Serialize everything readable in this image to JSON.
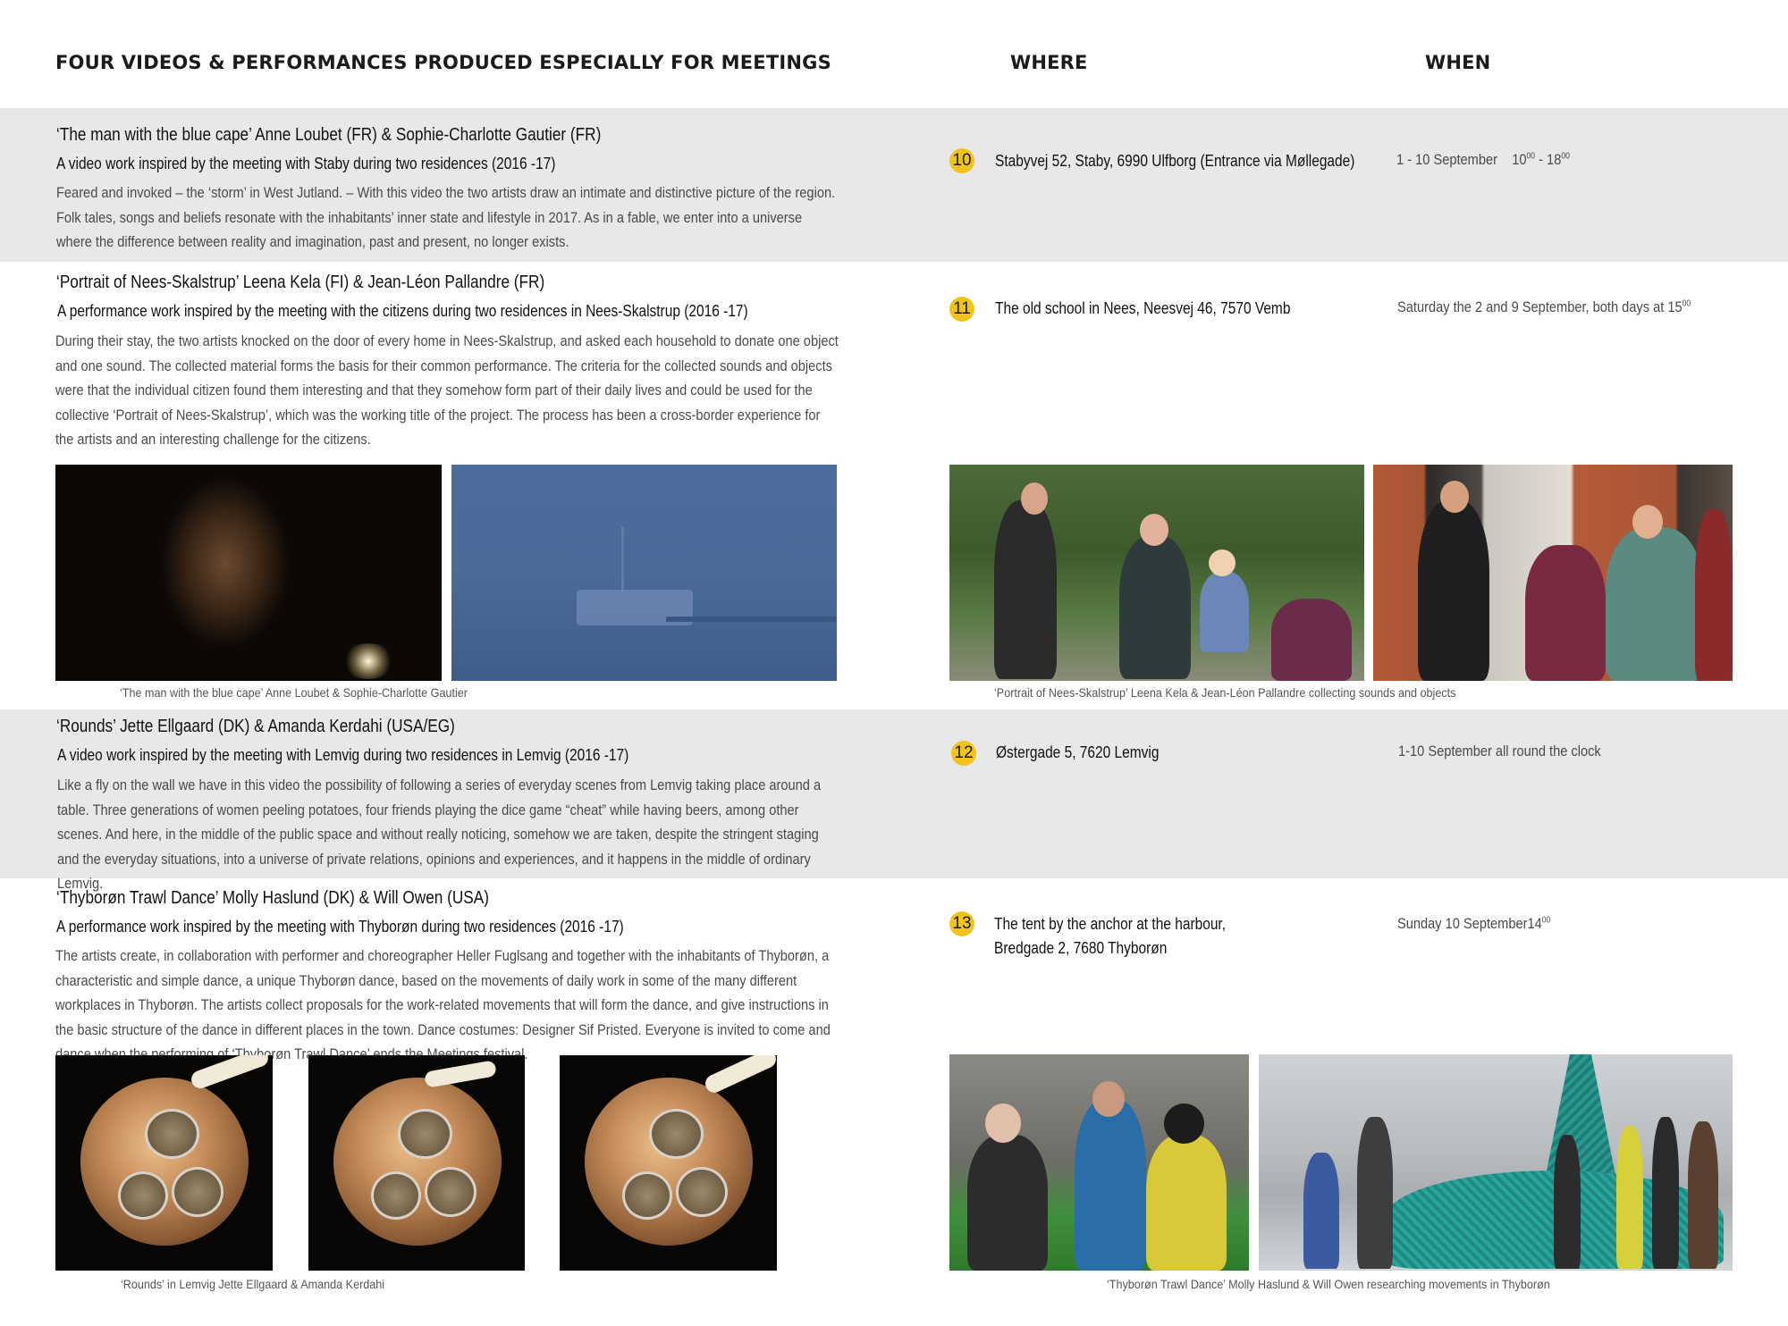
{
  "header": {
    "title": "FOUR VIDEOS & PERFORMANCES PRODUCED ESPECIALLY FOR MEETINGS",
    "where": "WHERE",
    "when": "WHEN"
  },
  "events": [
    {
      "number": "10",
      "title": "‘The man with the blue cape’      Anne Loubet (FR) & Sophie-Charlotte Gautier (FR)",
      "subtitle": "A video work inspired by the meeting with Staby during two residences (2016 -17)",
      "body": "Feared and invoked – the ‘storm’ in West Jutland. – With this video the two artists draw an intimate and distinctive picture of the region. Folk tales, songs and beliefs resonate with the inhabitants’ inner state and lifestyle in 2017. As in a fable, we enter into a universe where the difference between reality and imagination, past and present, no longer exists.",
      "where": "Stabyvej 52, Staby, 6990 Ulfborg  (Entrance via Møllegade)",
      "when_date": "1 - 10  September",
      "when_start": "10",
      "when_start_sup": "00",
      "when_sep": " - 18",
      "when_end_sup": "00"
    },
    {
      "number": "11",
      "title": "‘Portrait of Nees-Skalstrup’  Leena Kela (FI) & Jean-Léon Pallandre (FR)",
      "subtitle": "A performance work inspired by the meeting with the citizens during two residences in Nees-Skalstrup (2016 -17)",
      "body": "During their stay, the two artists knocked on the door of every home in Nees-Skalstrup, and asked each household to donate one object and one sound. The collected material forms the basis for their common performance. The criteria for the collected sounds and objects were that the individual citizen found them interesting and that they somehow form part of their daily lives and could be used for the collective ‘Portrait of Nees-Skalstrup’, which was the working title of the project. The process has been a cross-border experience for the artists and an interesting challenge for the citizens.",
      "where": "The old school in Nees, Neesvej 46, 7570 Vemb",
      "when_text": "Saturday the 2 and 9 September, both days at 15",
      "when_sup": "00"
    },
    {
      "number": "12",
      "title": "‘Rounds’   Jette Ellgaard (DK) & Amanda Kerdahi (USA/EG)",
      "subtitle": "A video work inspired by the meeting with Lemvig during two residences in Lemvig (2016 -17)",
      "body": "Like a fly on the wall we have in this video the possibility of following a series of everyday scenes from Lemvig taking place around a table. Three generations of women peeling potatoes, four friends playing the dice game “cheat” while having beers, among other scenes. And here, in the middle of the public space and without really noticing, somehow we are taken, despite the stringent staging and the everyday situations, into a universe of private relations, opinions and experiences, and it happens in the middle of ordinary Lemvig.",
      "where": "Østergade 5, 7620 Lemvig",
      "when_text": "1-10 September all round the clock"
    },
    {
      "number": "13",
      "title": "‘Thyborøn Trawl Dance’  Molly Haslund (DK) & Will Owen (USA)",
      "subtitle": "A performance work inspired by the meeting with Thyborøn during two residences (2016 -17)",
      "body": "The artists create, in collaboration with performer and choreographer Heller Fuglsang and together with the inhabitants of Thyborøn, a characteristic and simple dance, a unique Thyborøn dance, based on the movements of daily work in some of the many different workplaces in Thyborøn. The artists collect proposals for the work-related movements that will form the dance, and give instructions in the basic structure of the dance in different places in the town. Dance costumes: Designer Sif Pristed. Everyone is invited to come and dance when the performing of ‘Thyborøn Trawl Dance’ ends the Meetings festival.",
      "where_line1": "The tent by the anchor at the harbour,",
      "where_line2": "Bredgade 2, 7680 Thyborøn",
      "when_text": "Sunday 10 September14",
      "when_sup": "00"
    }
  ],
  "captions": {
    "blue_cape": "‘The man with the blue cape’  Anne Loubet  & Sophie-Charlotte Gautier",
    "portrait": "‘Portrait of Nees-Skalstrup’ Leena Kela & Jean-Léon Pallandre collecting sounds and objects",
    "rounds": "‘Rounds’  in Lemvig    Jette Ellgaard & Amanda Kerdahi",
    "trawl": "‘Thyborøn Trawl Dance’  Molly Haslund &  Will Owen researching movements in Thyborøn"
  },
  "colors": {
    "band": "#e8e8e8",
    "badge": "#f2c31b"
  }
}
